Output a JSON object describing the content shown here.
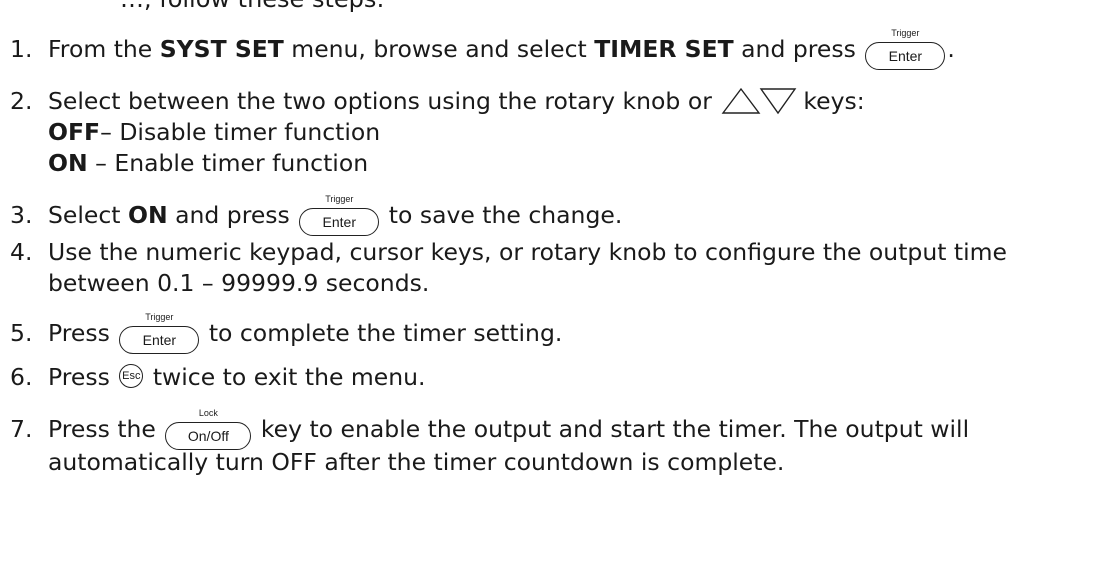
{
  "header_fragment": "…, follow these steps:",
  "steps": [
    {
      "num": "1.",
      "pre": "From the ",
      "menu": "SYST SET",
      "mid": " menu, browse and select ",
      "item": "TIMER SET",
      "post": " and press",
      "key_label": "Enter",
      "key_caption": "Trigger",
      "end": "."
    },
    {
      "num": "2.",
      "text": "Select between the two options using the rotary knob or",
      "arrow_icons": [
        "up-triangle-icon",
        "down-triangle-icon"
      ],
      "post": "keys:",
      "options": [
        {
          "name": "OFF",
          "sep": "–",
          "desc": " Disable timer function"
        },
        {
          "name": "ON",
          "sep": " –",
          "desc": " Enable timer function"
        }
      ]
    },
    {
      "num": "3.",
      "pre": "Select ",
      "bold": "ON",
      "mid": " and press",
      "key_label": "Enter",
      "key_caption": "Trigger",
      "post": "to save the change."
    },
    {
      "num": "4.",
      "line1": "Use the numeric keypad, cursor keys, or rotary knob to configure the output time",
      "line2": "between 0.1 – 99999.9 seconds."
    },
    {
      "num": "5.",
      "pre": "Press",
      "key_label": "Enter",
      "key_caption": "Trigger",
      "post": "to complete the timer setting."
    },
    {
      "num": "6.",
      "pre": "Press",
      "key_label": "Esc",
      "post": "twice to exit the menu."
    },
    {
      "num": "7.",
      "pre": "Press the",
      "key_label": "On/Off",
      "key_caption": "Lock",
      "post": "key to enable the output and start the timer. The output will",
      "line2": "automatically turn OFF after the timer countdown is complete."
    }
  ]
}
